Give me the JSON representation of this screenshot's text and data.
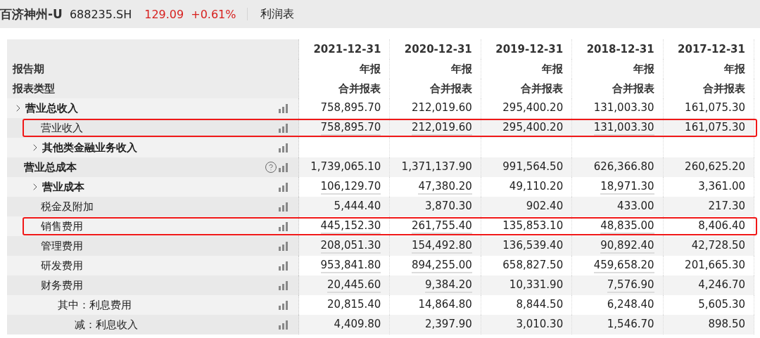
{
  "header": {
    "stock_name": "百济神州-U",
    "code": "688235.SH",
    "price": "129.09",
    "change": "+0.61%",
    "report": "利润表"
  },
  "table": {
    "header_rows": [
      {
        "values": [
          "2021-12-31",
          "2020-12-31",
          "2019-12-31",
          "2018-12-31",
          "2017-12-31"
        ]
      },
      {
        "label": "报告期",
        "values": [
          "年报",
          "年报",
          "年报",
          "年报",
          "年报"
        ]
      },
      {
        "label": "报表类型",
        "values": [
          "合并报表",
          "合并报表",
          "合并报表",
          "合并报表",
          "合并报表"
        ]
      }
    ],
    "rows": [
      {
        "label": "营业总收入",
        "bold": true,
        "expandable": true,
        "help": false,
        "highlighted": false,
        "values": [
          {
            "text": "758,895.70",
            "linked": false
          },
          {
            "text": "212,019.60",
            "linked": false
          },
          {
            "text": "295,400.20",
            "linked": false
          },
          {
            "text": "131,003.30",
            "linked": false
          },
          {
            "text": "161,075.30",
            "linked": false
          }
        ],
        "children": [
          {
            "label": "营业收入",
            "bold": false,
            "expandable": false,
            "help": false,
            "highlighted": true,
            "values": [
              {
                "text": "758,895.70",
                "linked": true
              },
              {
                "text": "212,019.60",
                "linked": true
              },
              {
                "text": "295,400.20",
                "linked": false
              },
              {
                "text": "131,003.30",
                "linked": true
              },
              {
                "text": "161,075.30",
                "linked": false
              }
            ]
          },
          {
            "label": "其他类金融业务收入",
            "bold": true,
            "expandable": true,
            "help": false,
            "highlighted": false
          }
        ]
      },
      {
        "label": "营业总成本",
        "bold": true,
        "expandable": false,
        "help": true,
        "highlighted": false,
        "values": [
          {
            "text": "1,739,065.10",
            "linked": false
          },
          {
            "text": "1,371,137.90",
            "linked": false
          },
          {
            "text": "991,564.50",
            "linked": false
          },
          {
            "text": "626,366.80",
            "linked": false
          },
          {
            "text": "260,625.20",
            "linked": false
          }
        ],
        "children": [
          {
            "label": "营业成本",
            "bold": true,
            "expandable": true,
            "help": false,
            "highlighted": false,
            "values": [
              {
                "text": "106,129.70",
                "linked": true
              },
              {
                "text": "47,380.20",
                "linked": true
              },
              {
                "text": "49,110.20",
                "linked": false
              },
              {
                "text": "18,971.30",
                "linked": true
              },
              {
                "text": "3,361.00",
                "linked": false
              }
            ]
          },
          {
            "label": "税金及附加",
            "bold": false,
            "expandable": false,
            "help": false,
            "highlighted": false,
            "values": [
              {
                "text": "5,444.40",
                "linked": false
              },
              {
                "text": "3,870.30",
                "linked": false
              },
              {
                "text": "902.40",
                "linked": false
              },
              {
                "text": "433.00",
                "linked": false
              },
              {
                "text": "217.30",
                "linked": false
              }
            ]
          },
          {
            "label": "销售费用",
            "bold": false,
            "expandable": false,
            "help": false,
            "highlighted": true,
            "values": [
              {
                "text": "445,152.30",
                "linked": true
              },
              {
                "text": "261,755.40",
                "linked": true
              },
              {
                "text": "135,853.10",
                "linked": false
              },
              {
                "text": "48,835.00",
                "linked": true
              },
              {
                "text": "8,406.40",
                "linked": false
              }
            ]
          },
          {
            "label": "管理费用",
            "bold": false,
            "expandable": false,
            "help": false,
            "highlighted": false,
            "values": [
              {
                "text": "208,051.30",
                "linked": true
              },
              {
                "text": "154,492.80",
                "linked": true
              },
              {
                "text": "136,539.40",
                "linked": false
              },
              {
                "text": "90,892.40",
                "linked": true
              },
              {
                "text": "42,728.50",
                "linked": false
              }
            ]
          },
          {
            "label": "研发费用",
            "bold": false,
            "expandable": false,
            "help": false,
            "highlighted": false,
            "values": [
              {
                "text": "953,841.80",
                "linked": true
              },
              {
                "text": "894,255.00",
                "linked": true
              },
              {
                "text": "658,827.50",
                "linked": false
              },
              {
                "text": "459,658.20",
                "linked": true
              },
              {
                "text": "201,665.30",
                "linked": false
              }
            ]
          },
          {
            "label": "财务费用",
            "bold": false,
            "expandable": false,
            "help": false,
            "highlighted": false,
            "values": [
              {
                "text": "20,445.60",
                "linked": true
              },
              {
                "text": "9,384.20",
                "linked": true
              },
              {
                "text": "10,331.90",
                "linked": false
              },
              {
                "text": "7,576.90",
                "linked": true
              },
              {
                "text": "4,246.70",
                "linked": false
              }
            ],
            "children": [
              {
                "label": "其中：利息费用",
                "bold": false,
                "expandable": false,
                "help": false,
                "highlighted": false,
                "values": [
                  {
                    "text": "20,815.40",
                    "linked": false
                  },
                  {
                    "text": "14,864.80",
                    "linked": false
                  },
                  {
                    "text": "8,844.50",
                    "linked": false
                  },
                  {
                    "text": "6,248.40",
                    "linked": false
                  },
                  {
                    "text": "5,605.30",
                    "linked": false
                  }
                ],
                "children": [
                  {
                    "label": "减：利息收入",
                    "bold": false,
                    "expandable": false,
                    "help": false,
                    "highlighted": false,
                    "values": [
                      {
                        "text": "4,409.80",
                        "linked": false
                      },
                      {
                        "text": "2,397.90",
                        "linked": false
                      },
                      {
                        "text": "3,010.30",
                        "linked": false
                      },
                      {
                        "text": "1,546.70",
                        "linked": false
                      },
                      {
                        "text": "898.50",
                        "linked": false
                      }
                    ]
                  }
                ]
              }
            ]
          }
        ]
      }
    ]
  }
}
